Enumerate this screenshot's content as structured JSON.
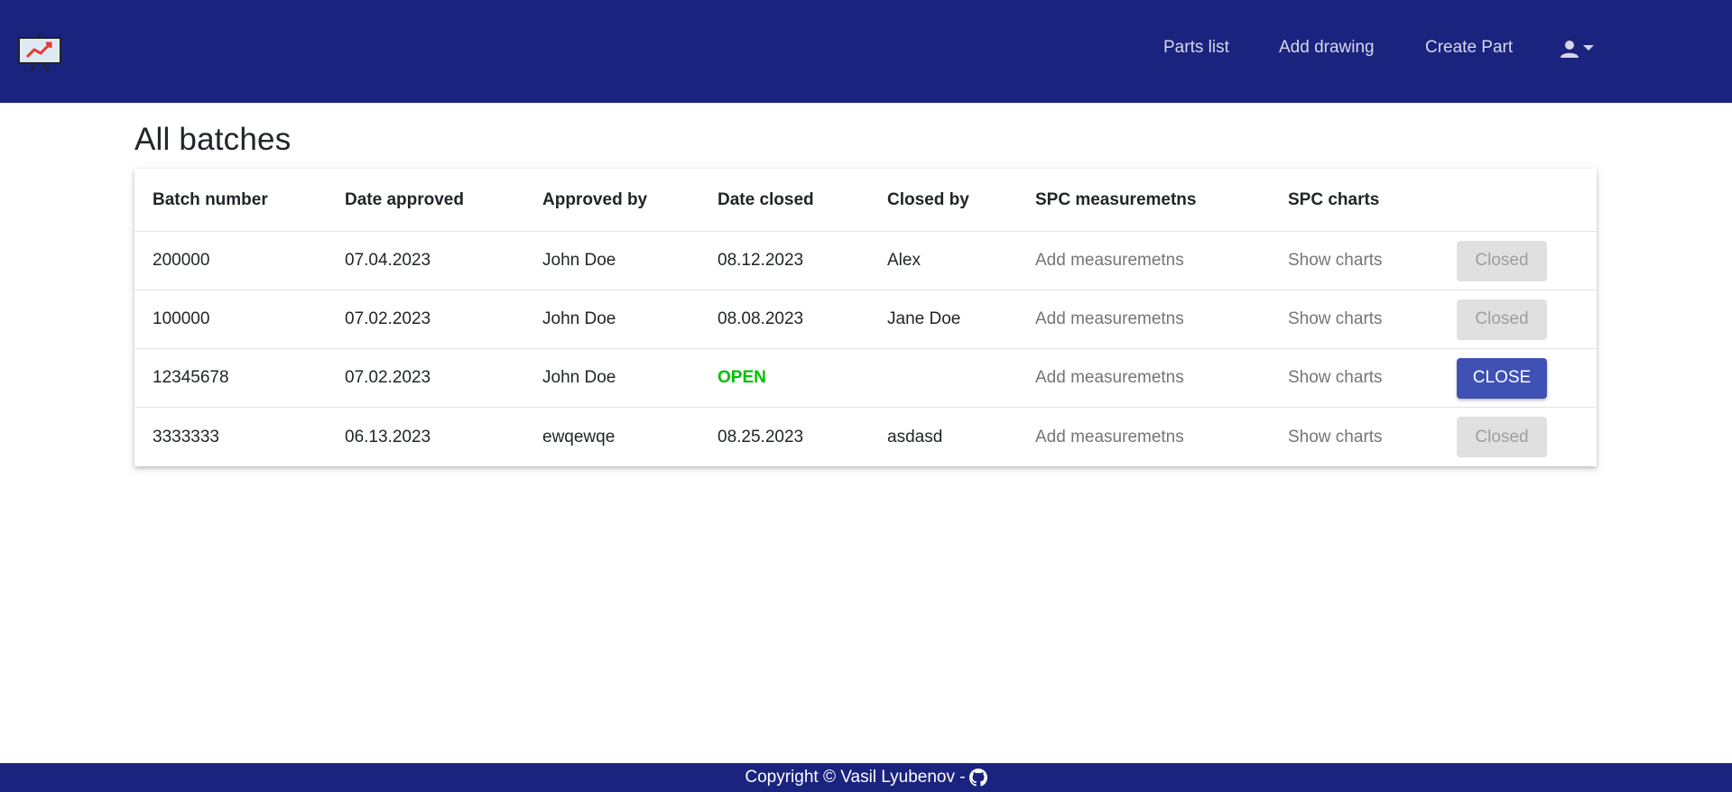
{
  "nav": {
    "links": [
      "Parts list",
      "Add drawing",
      "Create Part"
    ],
    "user_icon": "person-icon",
    "caret_icon": "caret-down-icon",
    "logo_icon": "chart-presentation-logo"
  },
  "page": {
    "title": "All batches"
  },
  "table": {
    "headers": [
      "Batch number",
      "Date approved",
      "Approved by",
      "Date closed",
      "Closed by",
      "SPC measuremetns",
      "SPC charts"
    ],
    "rows": [
      {
        "batch": "200000",
        "date_approved": "07.04.2023",
        "approved_by": "John Doe",
        "date_closed": "08.12.2023",
        "closed_by": "Alex",
        "measurements": "Add measuremetns",
        "charts": "Show charts",
        "action": "Closed"
      },
      {
        "batch": "100000",
        "date_approved": "07.02.2023",
        "approved_by": "John Doe",
        "date_closed": "08.08.2023",
        "closed_by": "Jane Doe",
        "measurements": "Add measuremetns",
        "charts": "Show charts",
        "action": "Closed"
      },
      {
        "batch": "12345678",
        "date_approved": "07.02.2023",
        "approved_by": "John Doe",
        "date_closed": "OPEN",
        "closed_by": "",
        "measurements": "Add measuremetns",
        "charts": "Show charts",
        "action": "CLOSE"
      },
      {
        "batch": "3333333",
        "date_approved": "06.13.2023",
        "approved_by": "ewqewqe",
        "date_closed": "08.25.2023",
        "closed_by": "asdasd",
        "measurements": "Add measuremetns",
        "charts": "Show charts",
        "action": "Closed"
      }
    ]
  },
  "footer": {
    "text": "Copyright © Vasil Lyubenov -",
    "icon": "github-icon"
  },
  "colors": {
    "navbar": "#1a237e",
    "primary_button": "#3f51b5",
    "open_status": "#00c000",
    "disabled_button": "#e0e0e0"
  }
}
